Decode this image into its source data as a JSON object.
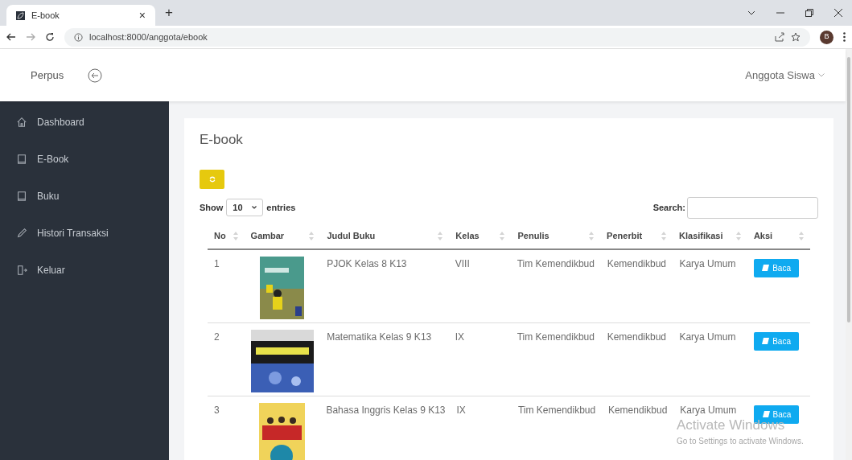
{
  "browser": {
    "tab_title": "E-book",
    "tab_close": "×",
    "new_tab": "+",
    "url": "localhost:8000/anggota/ebook",
    "profile_initial": "B"
  },
  "header": {
    "brand": "Perpus",
    "user_menu": "Anggota Siswa"
  },
  "sidebar": {
    "items": [
      {
        "label": "Dashboard",
        "kind": "home",
        "selected": false
      },
      {
        "label": "E-Book",
        "kind": "book",
        "selected": false
      },
      {
        "label": "Buku",
        "kind": "book",
        "selected": false
      },
      {
        "label": "Histori Transaksi",
        "kind": "pencil",
        "selected": false
      },
      {
        "label": "Keluar",
        "kind": "logout",
        "selected": false
      }
    ]
  },
  "page": {
    "title": "E-book",
    "length_label_before": "Show",
    "length_value": "10",
    "length_label_after": "entries",
    "search_label": "Search:"
  },
  "table": {
    "columns": [
      "No",
      "Gambar",
      "Judul Buku",
      "Kelas",
      "Penulis",
      "Penerbit",
      "Klasifikasi",
      "Aksi"
    ],
    "rows": [
      {
        "no": "1",
        "title": "PJOK Kelas 8 K13",
        "kelas": "VIII",
        "penulis": "Tim Kemendikbud",
        "penerbit": "Kemendikbud",
        "klasifikasi": "Karya Umum",
        "action": "Baca"
      },
      {
        "no": "2",
        "title": "Matematika Kelas 9 K13",
        "kelas": "IX",
        "penulis": "Tim Kemendikbud",
        "penerbit": "Kemendikbud",
        "klasifikasi": "Karya Umum",
        "action": "Baca"
      },
      {
        "no": "3",
        "title": "Bahasa Inggris Kelas 9 K13",
        "kelas": "IX",
        "penulis": "Tim Kemendikbud",
        "penerbit": "Kemendikbud",
        "klasifikasi": "Karya Umum",
        "action": "Baca"
      }
    ]
  },
  "os_overlay": {
    "title": "Activate Windows",
    "subtitle": "Go to Settings to activate Windows."
  }
}
